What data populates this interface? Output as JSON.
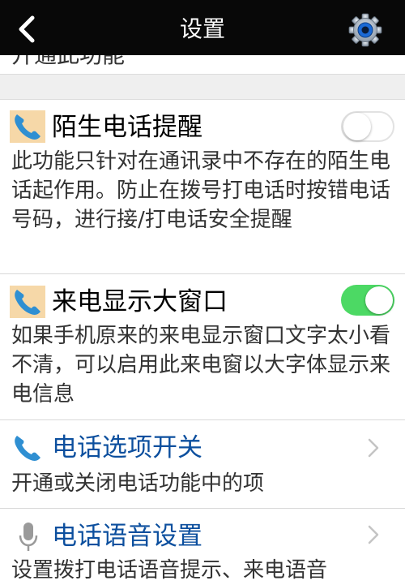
{
  "header": {
    "title": "设置",
    "back_icon": "chevron-left-icon",
    "settings_icon": "gear-icon"
  },
  "top_clipped_text": "开通此功能",
  "items": [
    {
      "icon": "phone-icon",
      "title": "陌生电话提醒",
      "description": "此功能只针对在通讯录中不存在的陌生电话起作用。防止在拨号打电话时按错电话号码，进行接/打电话安全提醒",
      "control": "toggle",
      "enabled": false
    },
    {
      "icon": "phone-icon",
      "title": "来电显示大窗口",
      "description": "如果手机原来的来电显示窗口文字太小看不清，可以启用此来电窗以大字体显示来电信息",
      "control": "toggle",
      "enabled": true
    },
    {
      "icon": "phone-icon",
      "title": "电话选项开关",
      "description": "开通或关闭电话功能中的项",
      "control": "chevron-right-icon"
    },
    {
      "icon": "microphone-icon",
      "title": "电话语音设置",
      "description": "设置拨打电话语音提示、来电语音",
      "control": "chevron-right-icon"
    }
  ],
  "colors": {
    "header_bg": "#080808",
    "toggle_on": "#4cd964",
    "title_blue": "#0c4f9e",
    "icon_blue": "#2f8fd2",
    "section_gap": "#efefef"
  }
}
